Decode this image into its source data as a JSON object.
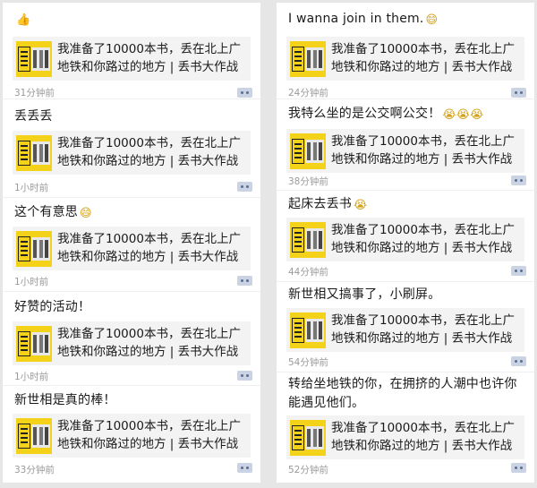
{
  "shared_article": {
    "title": "我准备了10000本书，丢在北上广地铁和你路过的地方 | 丢书大作战"
  },
  "left_feed": [
    {
      "text": "",
      "emoji": "👍",
      "time": "31分钟前"
    },
    {
      "text": "丢丢丢",
      "emoji": "",
      "time": "1小时前"
    },
    {
      "text": "这个有意思",
      "emoji": "😄",
      "time": "1小时前"
    },
    {
      "text": "好赞的活动！",
      "emoji": "",
      "time": "1小时前"
    },
    {
      "text": "新世相是真的棒！",
      "emoji": "",
      "time": "33分钟前"
    }
  ],
  "right_feed": [
    {
      "text": "I wanna join in them.",
      "emoji": "😄",
      "time": "24分钟前"
    },
    {
      "text": "我特么坐的是公交啊公交！",
      "emoji": "😭😭😭",
      "time": "38分钟前"
    },
    {
      "text": "起床去丢书",
      "emoji": "😭",
      "time": "44分钟前"
    },
    {
      "text": "新世相又搞事了，小刷屏。",
      "emoji": "",
      "time": "54分钟前"
    },
    {
      "text": "转给坐地铁的你，在拥挤的人潮中也许你能遇见他们。",
      "emoji": "",
      "time": "52分钟前"
    }
  ],
  "colors": {
    "link_blue": "#5a6e93",
    "time_gray": "#9a9a9a",
    "card_bg": "#f3f3f3",
    "thumb_yellow": "#f5d21a"
  },
  "icons": {
    "thumb": "book-cover-thumbnail",
    "more": "more-dots-icon"
  }
}
